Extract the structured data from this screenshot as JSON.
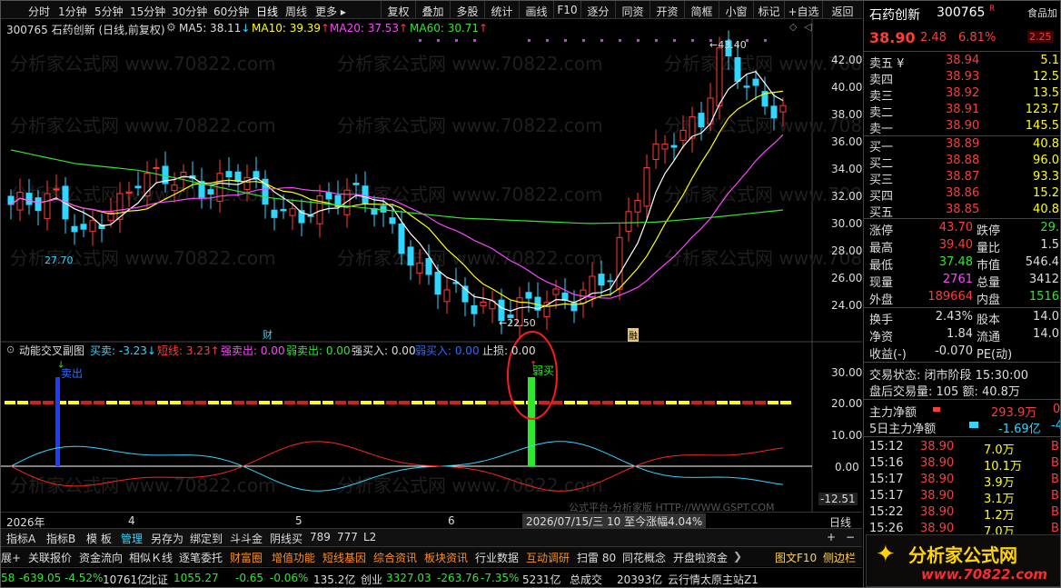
{
  "toolbar": {
    "periods": [
      "分时",
      "1分钟",
      "5分钟",
      "15分钟",
      "30分钟",
      "60分钟",
      "日线",
      "周线",
      "更多 ▸"
    ],
    "buttons": [
      "复权",
      "叠加",
      "多股",
      "统计",
      "画线",
      "F10",
      "逐分",
      "同资",
      "开资",
      "简框",
      "小窗",
      "标记",
      "+自选",
      "返回"
    ]
  },
  "chart_header": {
    "code_name": "300765 石药创新 (日线,前复权)",
    "ma5": "MA5: 38.11",
    "ma5_arrow": "↓",
    "ma10": "MA10: 39.39",
    "ma10_arrow": "↑",
    "ma20": "MA20: 37.53",
    "ma20_arrow": "↑",
    "ma60": "MA60: 30.71",
    "ma60_arrow": "↑"
  },
  "price_axis": [
    "42.00",
    "40.00",
    "38.00",
    "36.00",
    "34.00",
    "32.00",
    "30.00",
    "28.00",
    "26.00",
    "24.00"
  ],
  "annotations": {
    "high": "43.40",
    "low_left": "27.70",
    "low_mid": "22.50",
    "cai": "财",
    "rong": "融"
  },
  "sub_header": {
    "name": "动能交叉副图",
    "mai": "买卖: -3.23",
    "mai_arrow": "↓",
    "short": "短线: 3.23",
    "short_arrow": "↑",
    "qmc": "强卖出: 0.00",
    "rmc": "弱卖出: 0.00",
    "qmr": "强买入: 0.00",
    "rmr": "弱买入: 0.00",
    "stop": "止损: 0.00"
  },
  "sub_axis": [
    "30.00",
    "20.00",
    "10.00",
    "0.00",
    "-12.51"
  ],
  "sub_labels": {
    "left": "卖出",
    "mid": "弱买"
  },
  "watermark": "分析家公式网 www.70822.com",
  "date_axis": {
    "year": "2026年",
    "m4": "4",
    "m5": "5",
    "m6": "6",
    "cursor": "2026/07/15/三 10 至今涨幅4.04%",
    "period": "日线",
    "src": "公式平台-分析家版 HTTP://WWW.GSPT.COM"
  },
  "bottom_tabs": [
    "指标A",
    "指标B",
    "模 板",
    "管理",
    "另存为",
    "绑定到",
    "斗斗金",
    "阴线买",
    "789",
    "777",
    "L2"
  ],
  "module_bar": [
    "展+",
    "关联报价",
    "资金流向",
    "相似Ｋ线",
    "逐笔委托",
    "财富圈",
    "增值功能",
    "短线基因",
    "综合资讯",
    "板块资讯",
    "行业数据",
    "互动调研",
    "扫雷 80",
    "同花概念",
    "开盘啦资金",
    "❯",
    "图文F10",
    "侧边栏"
  ],
  "status_bar": [
    "58",
    "-639.05",
    "-4.52%",
    "10761亿",
    "北证",
    "1055.27",
    "-0.65",
    "-0.06%",
    "135.2亿",
    "创业",
    "3327.03",
    "-263.76",
    "-7.35%",
    "5231亿",
    "总成交",
    "20393亿",
    "云行情太原主站Z1"
  ],
  "quote": {
    "title": "石药创新",
    "code": "300765",
    "r_mark": "R",
    "tag1": "食品加",
    "tag2": "2.25",
    "price": "38.90",
    "change": "2.48",
    "pct": "6.81%",
    "asks": [
      {
        "label": "卖五 ¥",
        "price": "38.94",
        "vol": "5.1"
      },
      {
        "label": "卖四",
        "price": "38.93",
        "vol": "12.5"
      },
      {
        "label": "卖三",
        "price": "38.92",
        "vol": "13.5"
      },
      {
        "label": "卖二",
        "price": "38.91",
        "vol": "123.7"
      },
      {
        "label": "卖一",
        "price": "38.90",
        "vol": "145.5"
      }
    ],
    "bids": [
      {
        "label": "买一",
        "price": "38.89",
        "vol": "40.8"
      },
      {
        "label": "买二",
        "price": "38.88",
        "vol": "96.0"
      },
      {
        "label": "买三",
        "price": "38.87",
        "vol": "93.3"
      },
      {
        "label": "买四",
        "price": "38.86",
        "vol": "15.2"
      },
      {
        "label": "买五",
        "price": "38.85",
        "vol": "40.8"
      }
    ],
    "stats": [
      {
        "l1": "涨停",
        "v1": "43.70",
        "l2": "跌停",
        "v2": "29."
      },
      {
        "l1": "最高",
        "v1": "39.40",
        "l2": "量比",
        "v2": "1.5"
      },
      {
        "l1": "最低",
        "v1": "37.48",
        "l2": "市值",
        "v2": "546.4"
      },
      {
        "l1": "现量",
        "v1": "2761",
        "l2": "总量",
        "v2": "3412"
      },
      {
        "l1": "外盘",
        "v1": "189664",
        "l2": "内盘",
        "v2": "1516"
      }
    ],
    "stats2": [
      {
        "l1": "换手",
        "v1": "2.43%",
        "l2": "股本",
        "v2": "14.0"
      },
      {
        "l1": "净资",
        "v1": "1.84",
        "l2": "流通",
        "v2": "14.0"
      },
      {
        "l1": "收益(-)",
        "v1": "-0.070",
        "l2": "PE(动)",
        "v2": ""
      }
    ],
    "trade_status": "交易状态: 闭市阶段 15:30:00",
    "after_hours": "盘后交易量: 105 额: 40.8万",
    "main_flow_label": "主力净额",
    "main_flow_val": "293.9万",
    "main_flow_tail": "0.",
    "flow5_label": "5日主力净额",
    "flow5_val": "-1.69亿",
    "flow5_tail": "-4",
    "ticks": [
      {
        "t": "15:12",
        "p": "38.90",
        "v": "7.0万",
        "d": "B"
      },
      {
        "t": "15:16",
        "p": "38.90",
        "v": "10.1万",
        "d": "B"
      },
      {
        "t": "15:17",
        "p": "38.90",
        "v": "3.9万",
        "d": "B"
      },
      {
        "t": "15:17",
        "p": "38.90",
        "v": "3.1万",
        "d": "B"
      },
      {
        "t": "15:22",
        "p": "38.90",
        "v": "1.2万",
        "d": "B"
      },
      {
        "t": "15:26",
        "p": "38.90",
        "v": "7.0万",
        "d": "B"
      }
    ],
    "logo_text": "分析家公式网",
    "logo_url": "www.70822.com"
  },
  "chart_data": {
    "type": "candlestick",
    "note": "",
    "ylim": [
      22,
      44
    ],
    "ma_series": [
      "MA5",
      "MA10",
      "MA20",
      "MA60"
    ]
  }
}
